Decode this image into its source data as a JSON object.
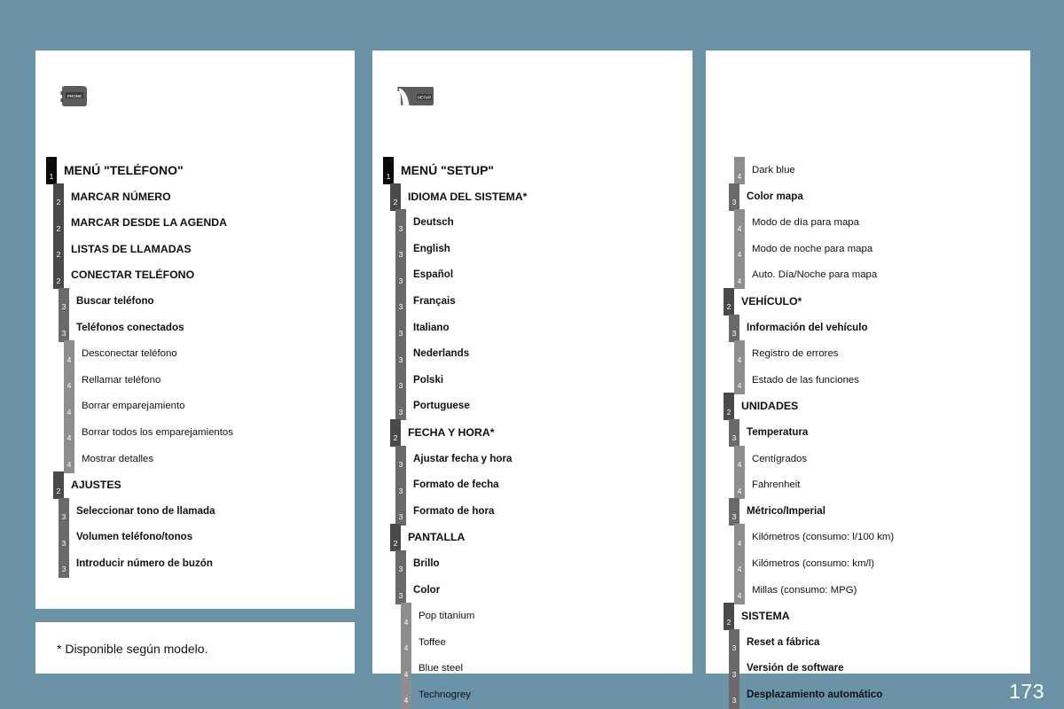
{
  "page": {
    "number": "173",
    "background_color": "#6b93a8",
    "panel_color": "#ffffff"
  },
  "badge_colors": {
    "level1": "#0a0a0a",
    "level2": "#4a4a4a",
    "level3": "#6a6a6a",
    "level4": "#8d8d8d"
  },
  "footnote": {
    "text": "* Disponible según modelo."
  },
  "columns": [
    {
      "id": "phone",
      "icon": "phone-button-icon",
      "icon_label": "PHONE",
      "items": [
        {
          "level": 1,
          "label": "MENÚ \"TELÉFONO\""
        },
        {
          "level": 2,
          "label": "MARCAR NÚMERO"
        },
        {
          "level": 2,
          "label": "MARCAR DESDE LA AGENDA"
        },
        {
          "level": 2,
          "label": "LISTAS DE LLAMADAS"
        },
        {
          "level": 2,
          "label": "CONECTAR TELÉFONO"
        },
        {
          "level": 3,
          "label": "Buscar teléfono"
        },
        {
          "level": 3,
          "label": "Teléfonos conectados"
        },
        {
          "level": 4,
          "label": "Desconectar teléfono"
        },
        {
          "level": 4,
          "label": "Rellamar teléfono"
        },
        {
          "level": 4,
          "label": "Borrar emparejamiento"
        },
        {
          "level": 4,
          "label": "Borrar todos los emparejamientos"
        },
        {
          "level": 4,
          "label": "Mostrar detalles"
        },
        {
          "level": 2,
          "label": "AJUSTES"
        },
        {
          "level": 3,
          "label": "Seleccionar tono de llamada"
        },
        {
          "level": 3,
          "label": "Volumen teléfono/tonos"
        },
        {
          "level": 3,
          "label": "Introducir número de buzón"
        }
      ]
    },
    {
      "id": "setup",
      "icon": "setup-button-icon",
      "icon_label": "SETUP",
      "items": [
        {
          "level": 1,
          "label": "MENÚ \"SETUP\""
        },
        {
          "level": 2,
          "label": "IDIOMA DEL SISTEMA*"
        },
        {
          "level": 3,
          "label": "Deutsch"
        },
        {
          "level": 3,
          "label": "English"
        },
        {
          "level": 3,
          "label": "Español"
        },
        {
          "level": 3,
          "label": "Français"
        },
        {
          "level": 3,
          "label": "Italiano"
        },
        {
          "level": 3,
          "label": "Nederlands"
        },
        {
          "level": 3,
          "label": "Polski"
        },
        {
          "level": 3,
          "label": "Portuguese"
        },
        {
          "level": 2,
          "label": "FECHA Y HORA*"
        },
        {
          "level": 3,
          "label": "Ajustar fecha y hora"
        },
        {
          "level": 3,
          "label": "Formato de fecha"
        },
        {
          "level": 3,
          "label": "Formato de hora"
        },
        {
          "level": 2,
          "label": "PANTALLA"
        },
        {
          "level": 3,
          "label": "Brillo"
        },
        {
          "level": 3,
          "label": "Color"
        },
        {
          "level": 4,
          "label": "Pop titanium"
        },
        {
          "level": 4,
          "label": "Toffee"
        },
        {
          "level": 4,
          "label": "Blue steel"
        },
        {
          "level": 4,
          "label": "Technogrey"
        }
      ]
    },
    {
      "id": "setup-continued",
      "icon": null,
      "icon_label": null,
      "items": [
        {
          "level": 4,
          "label": "Dark blue"
        },
        {
          "level": 3,
          "label": "Color mapa"
        },
        {
          "level": 4,
          "label": "Modo de día para mapa"
        },
        {
          "level": 4,
          "label": "Modo de noche para mapa"
        },
        {
          "level": 4,
          "label": "Auto. Día/Noche para mapa"
        },
        {
          "level": 2,
          "label": "VEHÍCULO*"
        },
        {
          "level": 3,
          "label": "Información del vehículo"
        },
        {
          "level": 4,
          "label": "Registro de errores"
        },
        {
          "level": 4,
          "label": "Estado de las funciones"
        },
        {
          "level": 2,
          "label": "UNIDADES"
        },
        {
          "level": 3,
          "label": "Temperatura"
        },
        {
          "level": 4,
          "label": "Centígrados"
        },
        {
          "level": 4,
          "label": "Fahrenheit"
        },
        {
          "level": 3,
          "label": "Métrico/Imperial"
        },
        {
          "level": 4,
          "label": "Kilómetros (consumo: l/100 km)"
        },
        {
          "level": 4,
          "label": "Kilómetros (consumo: km/l)"
        },
        {
          "level": 4,
          "label": "Millas (consumo: MPG)"
        },
        {
          "level": 2,
          "label": "SISTEMA"
        },
        {
          "level": 3,
          "label": "Reset a fábrica"
        },
        {
          "level": 3,
          "label": "Versión de software"
        },
        {
          "level": 3,
          "label": "Desplazamiento automático"
        }
      ]
    }
  ]
}
